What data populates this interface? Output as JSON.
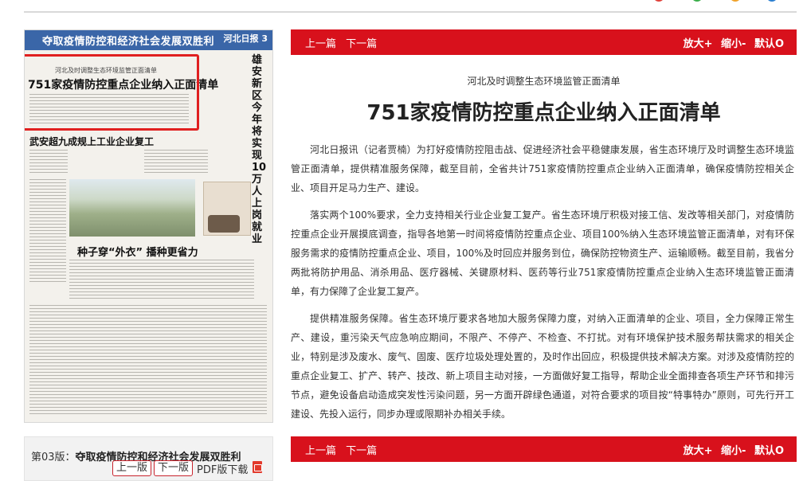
{
  "nav": {
    "prev": "上一篇",
    "next": "下一篇",
    "zoom_in": "放大+",
    "zoom_out": "缩小-",
    "default": "默认O"
  },
  "paper": {
    "banner": "夺取疫情防控和经济社会发展双胜利",
    "masthead": "河北日报 3",
    "subheadline": "河北及时调整生态环境监管正面清单",
    "headline": "751家疫情防控重点企业纳入正面清单",
    "side_headline": "雄安新区今年将实现10万人上岗就业",
    "story2": "武安超九成规上工业企业复工",
    "story3": "种子穿“外衣” 播种更省力"
  },
  "edition": {
    "label": "第03版：",
    "title": "夺取疫情防控和经济社会发展双胜利",
    "prev_page": "上一版",
    "next_page": "下一版",
    "pdf": "PDF版下载"
  },
  "article": {
    "kicker": "河北及时调整生态环境监管正面清单",
    "title": "751家疫情防控重点企业纳入正面清单",
    "paragraphs": [
      "河北日报讯（记者贾楠）为打好疫情防控阻击战、促进经济社会平稳健康发展，省生态环境厅及时调整生态环境监管正面清单，提供精准服务保障，截至目前，全省共计751家疫情防控重点企业纳入正面清单，确保疫情防控相关企业、项目开足马力生产、建设。",
      "落实两个100%要求，全力支持相关行业企业复工复产。省生态环境厅积极对接工信、发改等相关部门，对疫情防控重点企业开展摸底调查，指导各地第一时间将疫情防控重点企业、项目100%纳入生态环境监管正面清单，对有环保服务需求的疫情防控重点企业、项目，100%及时回应并服务到位，确保防控物资生产、运输顺畅。截至目前，我省分两批将防护用品、消杀用品、医疗器械、关键原材料、医药等行业751家疫情防控重点企业纳入生态环境监管正面清单，有力保障了企业复工复产。",
      "提供精准服务保障。省生态环境厅要求各地加大服务保障力度，对纳入正面清单的企业、项目，全力保障正常生产、建设，重污染天气应急响应期间，不限产、不停产、不检查、不打扰。对有环境保护技术服务帮扶需求的相关企业，特别是涉及废水、废气、固废、医疗垃圾处理处置的，及时作出回应，积极提供技术解决方案。对涉及疫情防控的重点企业复工、扩产、转产、技改、新上项目主动对接，一方面做好复工指导，帮助企业全面排查各项生产环节和排污节点，避免设备启动造成突发性污染问题，另一方面开辟绿色通道，对符合要求的项目按“特事特办”原则，可先行开工建设、先投入运行，同步办理或限期补办相关手续。"
    ]
  },
  "colors": {
    "accent_red": "#d8111c",
    "banner_blue": "#3a66a8",
    "dot_red": "#e0413a",
    "dot_green": "#3aae4a",
    "dot_orange": "#f0a22a",
    "dot_blue": "#2b7fd0"
  }
}
